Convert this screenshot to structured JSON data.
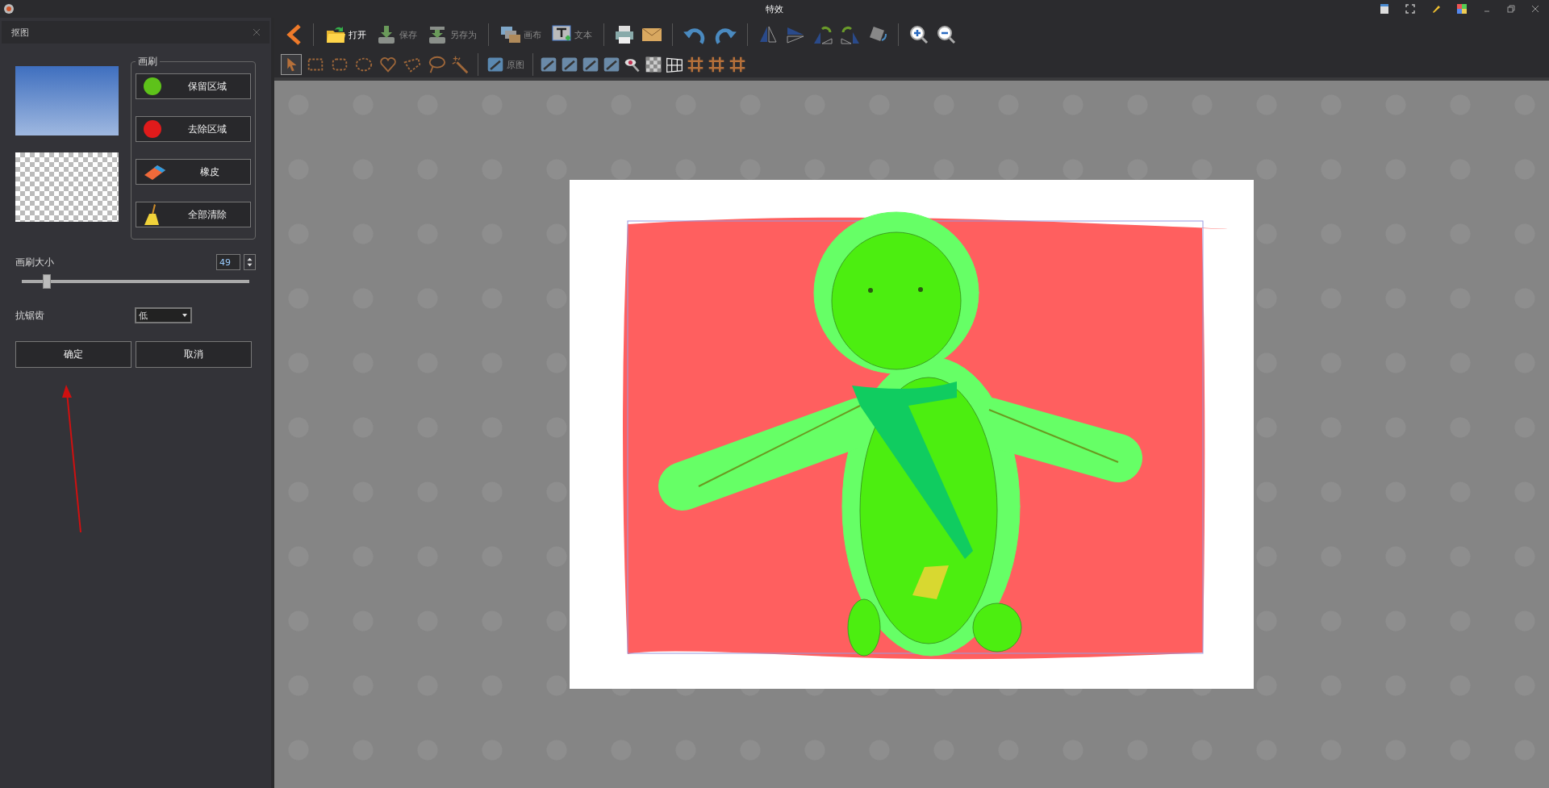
{
  "window": {
    "title": "特效"
  },
  "toolbar": {
    "file_buttons": [
      {
        "label": "打开",
        "kind": "open",
        "disabled": false
      },
      {
        "label": "保存",
        "kind": "save",
        "disabled": true
      },
      {
        "label": "另存为",
        "kind": "save-as",
        "disabled": true
      }
    ],
    "edit_buttons": [
      {
        "label": "画布",
        "kind": "canvas",
        "disabled": true
      },
      {
        "label": "文本",
        "kind": "text",
        "disabled": true
      }
    ],
    "select_tools": [
      {
        "kind": "pointer",
        "selected": true
      },
      {
        "kind": "rect",
        "selected": false
      },
      {
        "kind": "rounded-rect",
        "selected": false
      },
      {
        "kind": "ellipse",
        "selected": false
      },
      {
        "kind": "heart",
        "selected": false
      },
      {
        "kind": "polygon",
        "selected": false
      },
      {
        "kind": "lasso",
        "selected": false
      },
      {
        "kind": "magic-wand",
        "selected": false
      }
    ],
    "original_button": {
      "label": "原图"
    }
  },
  "panel": {
    "title": "抠图",
    "brush_group": {
      "title": "画刷",
      "buttons": [
        {
          "label": "保留区域",
          "kind": "keep"
        },
        {
          "label": "去除区域",
          "kind": "remove"
        },
        {
          "label": "橡皮",
          "kind": "eraser"
        },
        {
          "label": "全部清除",
          "kind": "clear"
        }
      ]
    },
    "brush_size": {
      "label": "画刷大小",
      "value": "49",
      "level": 0.11
    },
    "antialias": {
      "label": "抗锯齿",
      "value": "低"
    },
    "buttons": [
      "确定",
      "取消"
    ]
  }
}
